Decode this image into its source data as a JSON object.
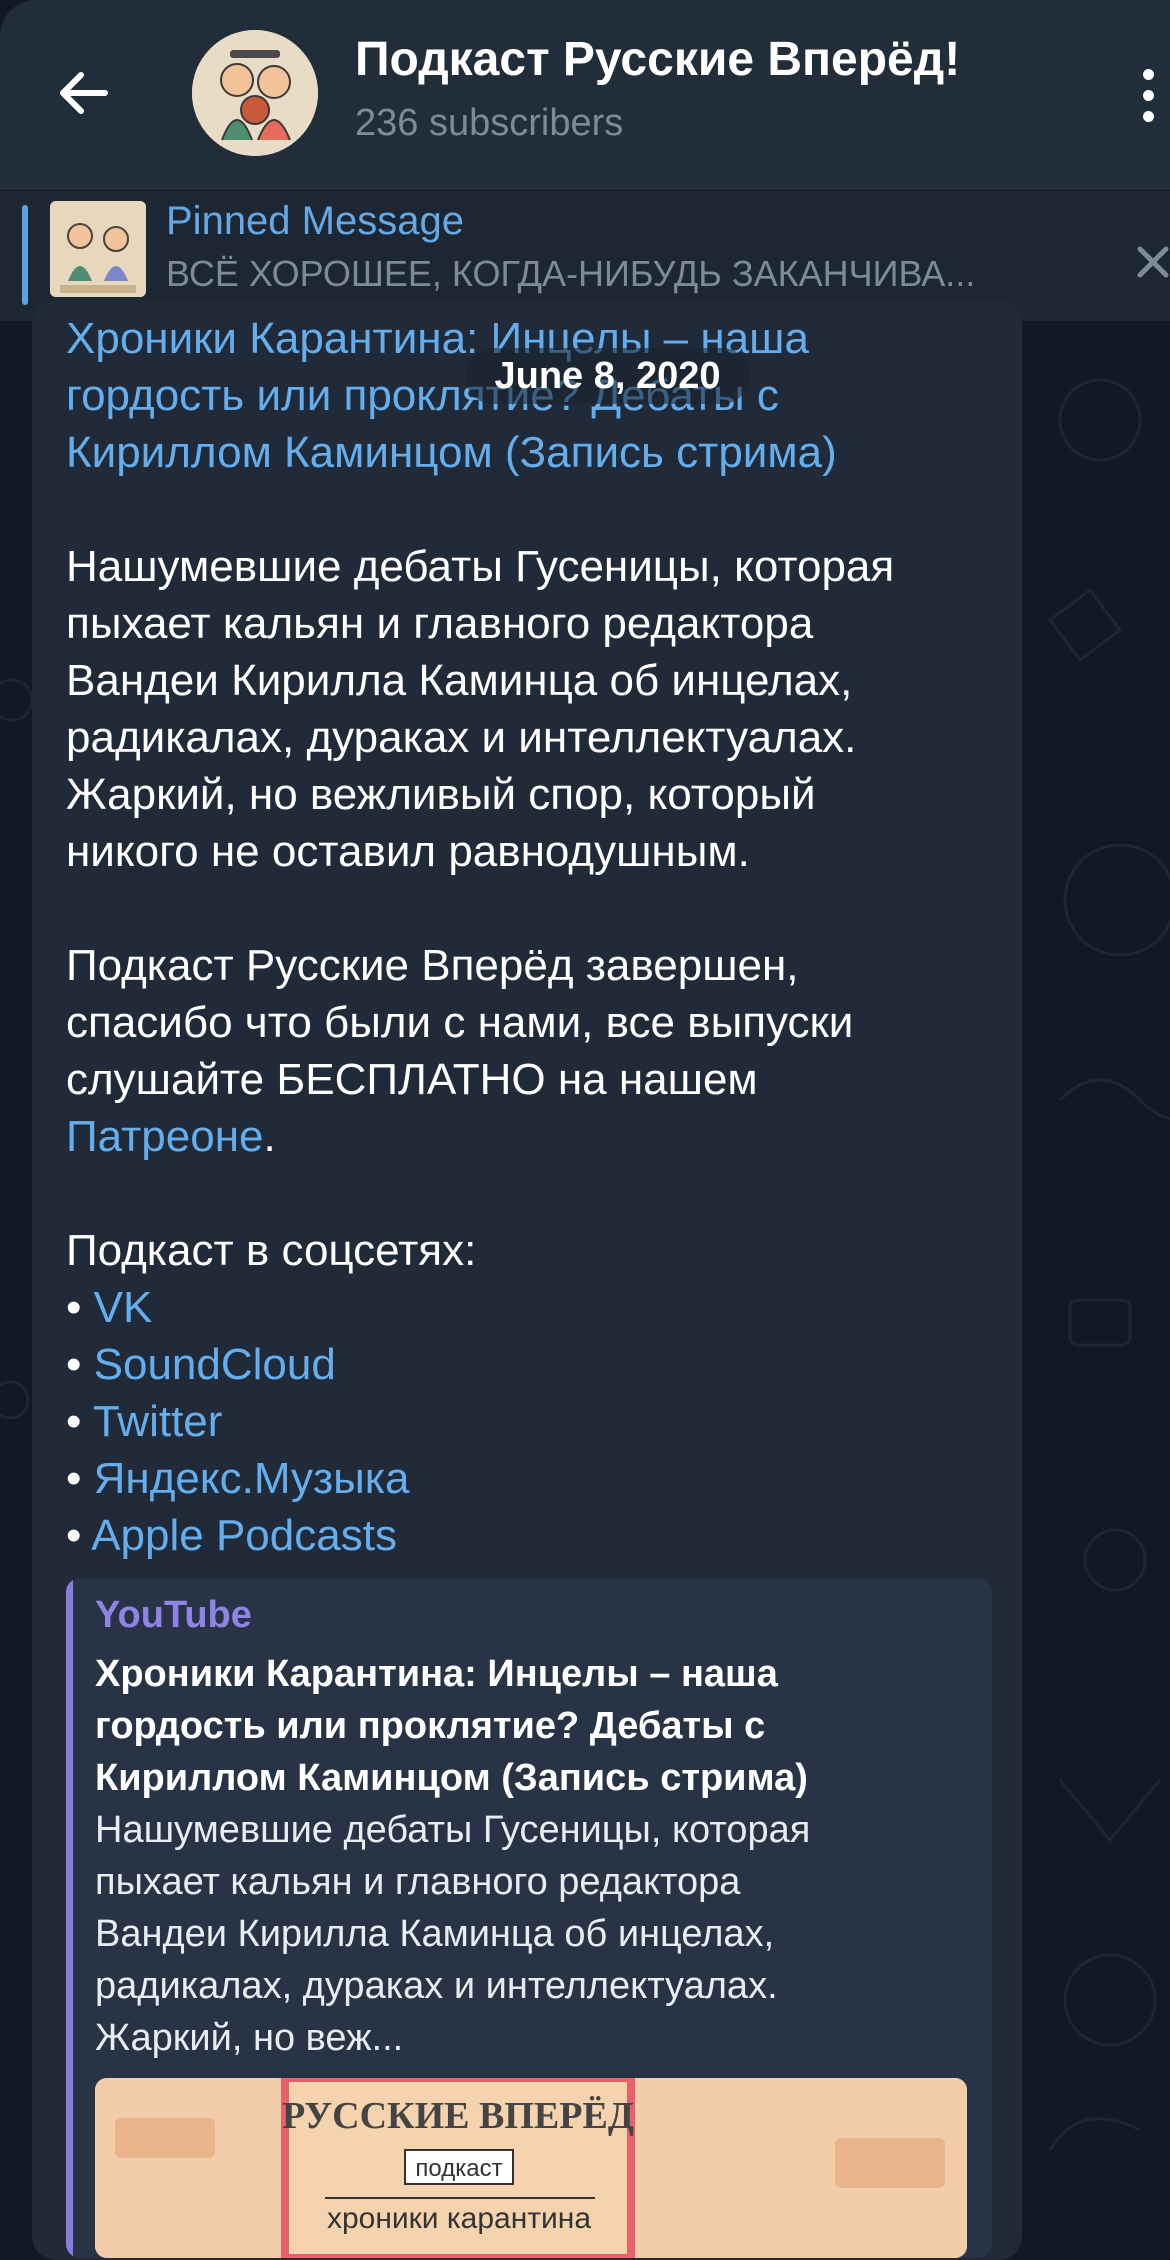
{
  "header": {
    "title": "Подкаст Русские Вперёд!",
    "subtitle": "236 subscribers",
    "back_icon": "arrow-left-icon",
    "menu_icon": "more-vertical-icon"
  },
  "pinned": {
    "label": "Pinned Message",
    "text": "ВСЁ ХОРОШЕЕ, КОГДА-НИБУДЬ ЗАКАНЧИВА...",
    "close_icon": "close-icon"
  },
  "date_badge": "June 8, 2020",
  "message": {
    "title_lines": [
      "Хроники Карантина: Инцелы – наша",
      "гордость или проклятие? Дебаты с",
      "Кириллом Каминцом (Запись стрима)"
    ],
    "body_lines": [
      "Нашумевшие дебаты Гусеницы, которая",
      "пыхает кальян и главного редактора",
      "Вандеи Кирилла Каминца об инцелах,",
      "радикалах, дураках и интеллектуалах.",
      "Жаркий, но вежливый спор, который",
      "никого не оставил равнодушным."
    ],
    "footer_lines": [
      "Подкаст Русские Вперёд завершен,",
      "спасибо что были с нами, все выпуски",
      "слушайте БЕСПЛАТНО на нашем"
    ],
    "patreon_link": "Патреоне",
    "patreon_suffix": ".",
    "social_heading": "Подкаст в соцсетях:",
    "bullet": "•",
    "social_links": [
      "VK",
      "SoundCloud",
      "Twitter",
      "Яндекс.Музыка",
      "Apple Podcasts"
    ]
  },
  "preview": {
    "site": "YouTube",
    "title_lines": [
      "Хроники Карантина: Инцелы – наша",
      "гордость или проклятие? Дебаты с",
      "Кириллом Каминцом (Запись стрима)"
    ],
    "desc_lines": [
      "Нашумевшие дебаты Гусеницы, которая",
      "пыхает кальян и главного редактора",
      "Вандеи Кирилла Каминца об инцелах,",
      "радикалах, дураках и интеллектуалах.",
      "Жаркий, но веж..."
    ],
    "image_heading": "РУССКИЕ ВПЕРЁД",
    "image_tag": "подкаст",
    "image_subtitle": "хроники карантина"
  },
  "colors": {
    "header_bg": "#222d3a",
    "chat_bg": "#111a24",
    "bubble_bg": "#202a38",
    "link": "#65aeed",
    "preview_accent": "#8a7be0"
  }
}
